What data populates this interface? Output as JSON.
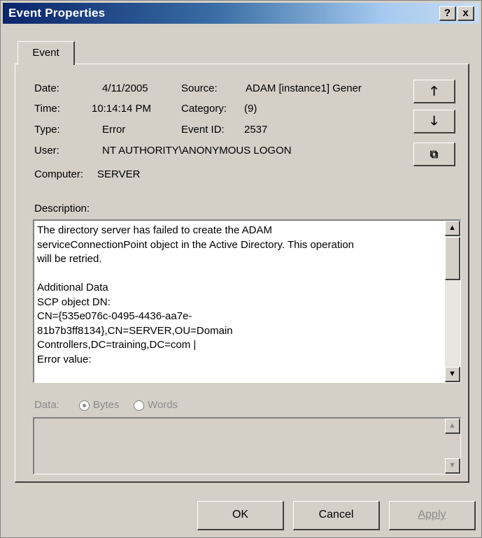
{
  "window": {
    "title": "Event Properties",
    "help_label": "?",
    "close_label": "x"
  },
  "tabs": [
    {
      "label": "Event",
      "selected": true
    }
  ],
  "fields": {
    "date_label": "Date:",
    "date_value": "4/11/2005",
    "source_label": "Source:",
    "source_value": "ADAM [instance1] Gener",
    "time_label": "Time:",
    "time_value": "10:14:14 PM",
    "category_label": "Category:",
    "category_value": "(9)",
    "type_label": "Type:",
    "type_value": "Error",
    "event_id_label": "Event ID:",
    "event_id_value": "2537",
    "user_label": "User:",
    "user_value": "NT AUTHORITY\\ANONYMOUS LOGON",
    "computer_label": "Computer:",
    "computer_value": "SERVER"
  },
  "side_buttons": {
    "up_icon": "arrow-up-icon",
    "up_glyph": "🡑",
    "down_icon": "arrow-down-icon",
    "down_glyph": "🡓",
    "copy_icon": "copy-icon",
    "copy_glyph": "⧉"
  },
  "description": {
    "label": "Description:",
    "lines": [
      "The directory server has failed to create the ADAM",
      "serviceConnectionPoint object in the Active Directory. This operation",
      "will be retried.",
      "",
      "Additional Data",
      "SCP object DN:",
      "CN={535e076c-0495-4436-aa7e-",
      "81b7b3ff8134},CN=SERVER,OU=Domain",
      "Controllers,DC=training,DC=com |",
      "Error value:"
    ]
  },
  "data_section": {
    "label": "Data:",
    "bytes_label": "Bytes",
    "words_label": "Words",
    "selected": "Bytes"
  },
  "buttons": {
    "ok": "OK",
    "cancel": "Cancel",
    "apply": "Apply"
  },
  "colors": {
    "title_start": "#0a246a",
    "title_end": "#a6caf0",
    "face": "#d4d0c8",
    "disabled_text": "#8a8a8a"
  }
}
